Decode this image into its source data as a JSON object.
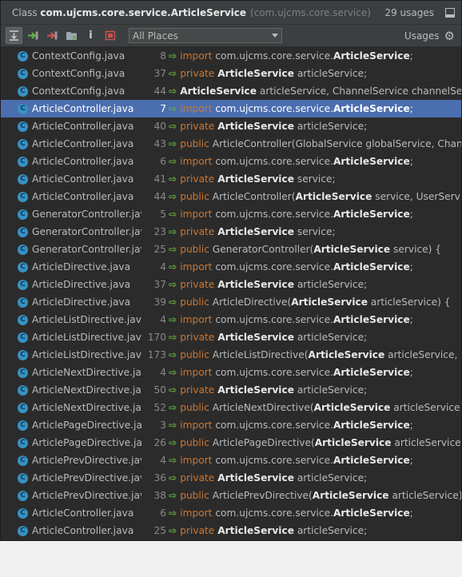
{
  "header": {
    "prefix": "Class",
    "class_name": "com.ujcms.core.service.ArticleService",
    "package": "(com.ujcms.core.service)",
    "usages_count": "29 usages"
  },
  "toolbar": {
    "scope": "All Places",
    "usages_label": "Usages",
    "info_label": "i"
  },
  "rows": [
    {
      "file": "ContextConfig.java",
      "line": "8",
      "pre": "import",
      "mid": " com.ujcms.core.service.",
      "bold": "ArticleService",
      "post": ";",
      "selected": false
    },
    {
      "file": "ContextConfig.java",
      "line": "37",
      "pre": "private",
      "mid": " ",
      "bold": "ArticleService",
      "post": " articleService;",
      "selected": false
    },
    {
      "file": "ContextConfig.java",
      "line": "44",
      "pre": "",
      "mid": "",
      "bold": "ArticleService",
      "post": " articleService, ChannelService channelService",
      "selected": false
    },
    {
      "file": "ArticleController.java",
      "line": "7",
      "pre": "import",
      "mid": " com.ujcms.core.service.",
      "bold": "ArticleService",
      "post": ";",
      "selected": true
    },
    {
      "file": "ArticleController.java",
      "line": "40",
      "pre": "private",
      "mid": " ",
      "bold": "ArticleService",
      "post": " articleService;",
      "selected": false
    },
    {
      "file": "ArticleController.java",
      "line": "43",
      "pre": "public",
      "mid": " ArticleController(GlobalService globalService, Channe",
      "bold": "",
      "post": "",
      "selected": false
    },
    {
      "file": "ArticleController.java",
      "line": "6",
      "pre": "import",
      "mid": " com.ujcms.core.service.",
      "bold": "ArticleService",
      "post": ";",
      "selected": false
    },
    {
      "file": "ArticleController.java",
      "line": "41",
      "pre": "private",
      "mid": " ",
      "bold": "ArticleService",
      "post": " service;",
      "selected": false
    },
    {
      "file": "ArticleController.java",
      "line": "44",
      "pre": "public",
      "mid": " ArticleController(",
      "bold": "ArticleService",
      "post": " service, UserService",
      "selected": false
    },
    {
      "file": "GeneratorController.java",
      "line": "5",
      "pre": "import",
      "mid": " com.ujcms.core.service.",
      "bold": "ArticleService",
      "post": ";",
      "selected": false
    },
    {
      "file": "GeneratorController.java",
      "line": "23",
      "pre": "private",
      "mid": " ",
      "bold": "ArticleService",
      "post": " service;",
      "selected": false
    },
    {
      "file": "GeneratorController.java",
      "line": "25",
      "pre": "public",
      "mid": " GeneratorController(",
      "bold": "ArticleService",
      "post": " service) {",
      "selected": false
    },
    {
      "file": "ArticleDirective.java",
      "line": "4",
      "pre": "import",
      "mid": " com.ujcms.core.service.",
      "bold": "ArticleService",
      "post": ";",
      "selected": false
    },
    {
      "file": "ArticleDirective.java",
      "line": "37",
      "pre": "private",
      "mid": " ",
      "bold": "ArticleService",
      "post": " articleService;",
      "selected": false
    },
    {
      "file": "ArticleDirective.java",
      "line": "39",
      "pre": "public",
      "mid": " ArticleDirective(",
      "bold": "ArticleService",
      "post": " articleService) {",
      "selected": false
    },
    {
      "file": "ArticleListDirective.java",
      "line": "4",
      "pre": "import",
      "mid": " com.ujcms.core.service.",
      "bold": "ArticleService",
      "post": ";",
      "selected": false
    },
    {
      "file": "ArticleListDirective.java",
      "line": "170",
      "pre": "private",
      "mid": " ",
      "bold": "ArticleService",
      "post": " articleService;",
      "selected": false
    },
    {
      "file": "ArticleListDirective.java",
      "line": "173",
      "pre": "public",
      "mid": " ArticleListDirective(",
      "bold": "ArticleService",
      "post": " articleService, Cha",
      "selected": false
    },
    {
      "file": "ArticleNextDirective.java",
      "line": "4",
      "pre": "import",
      "mid": " com.ujcms.core.service.",
      "bold": "ArticleService",
      "post": ";",
      "selected": false
    },
    {
      "file": "ArticleNextDirective.java",
      "line": "50",
      "pre": "private",
      "mid": " ",
      "bold": "ArticleService",
      "post": " articleService;",
      "selected": false
    },
    {
      "file": "ArticleNextDirective.java",
      "line": "52",
      "pre": "public",
      "mid": " ArticleNextDirective(",
      "bold": "ArticleService",
      "post": " articleService) {",
      "selected": false
    },
    {
      "file": "ArticlePageDirective.java",
      "line": "3",
      "pre": "import",
      "mid": " com.ujcms.core.service.",
      "bold": "ArticleService",
      "post": ";",
      "selected": false
    },
    {
      "file": "ArticlePageDirective.java",
      "line": "26",
      "pre": "public",
      "mid": " ArticlePageDirective(",
      "bold": "ArticleService",
      "post": " articleService, Ch",
      "selected": false
    },
    {
      "file": "ArticlePrevDirective.java",
      "line": "4",
      "pre": "import",
      "mid": " com.ujcms.core.service.",
      "bold": "ArticleService",
      "post": ";",
      "selected": false
    },
    {
      "file": "ArticlePrevDirective.java",
      "line": "36",
      "pre": "private",
      "mid": " ",
      "bold": "ArticleService",
      "post": " articleService;",
      "selected": false
    },
    {
      "file": "ArticlePrevDirective.java",
      "line": "38",
      "pre": "public",
      "mid": " ArticlePrevDirective(",
      "bold": "ArticleService",
      "post": " articleService) {",
      "selected": false
    },
    {
      "file": "ArticleController.java",
      "line": "6",
      "pre": "import",
      "mid": " com.ujcms.core.service.",
      "bold": "ArticleService",
      "post": ";",
      "selected": false
    },
    {
      "file": "ArticleController.java",
      "line": "25",
      "pre": "private",
      "mid": " ",
      "bold": "ArticleService",
      "post": " articleService;",
      "selected": false
    }
  ],
  "colors": {
    "keyword": "#cc7832",
    "selection": "#4b6eaf",
    "class_icon": "#3592c4",
    "arrow": "#62b543"
  }
}
